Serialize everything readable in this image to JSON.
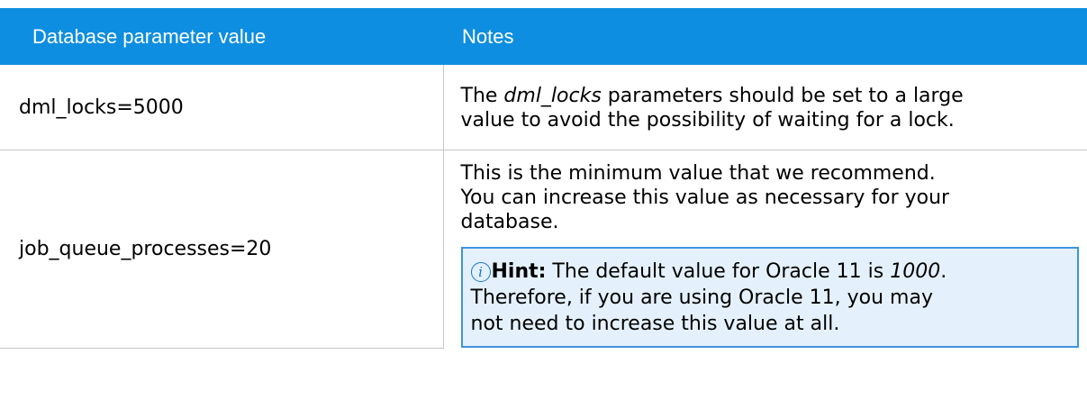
{
  "table": {
    "headers": {
      "parameter": "Database parameter value",
      "notes": "Notes"
    },
    "rows": [
      {
        "parameter": "dml_locks=5000",
        "note": {
          "line1_before": "The ",
          "line1_em": "dml_locks",
          "line1_after": " parameters should be set to a large",
          "line2": "value to avoid the possibility of waiting for a lock."
        }
      },
      {
        "parameter": "job_queue_processes=20",
        "note": {
          "line1": "This is the minimum value that we recommend.",
          "line2": "You can increase this value as necessary for your",
          "line3": "database."
        },
        "hint": {
          "icon": "info-icon",
          "icon_glyph": "i",
          "label": "Hint:",
          "line1_before": " The default value for Oracle 11 is ",
          "line1_em": "1000",
          "line1_after": ".",
          "line2": "Therefore, if you are using Oracle 11, you may",
          "line3": "not need to increase this value at all."
        }
      }
    ]
  },
  "colors": {
    "header_background": "#0e8ee0",
    "header_text": "#ffffff",
    "hint_background": "#e4f1fc",
    "hint_border": "#3d94e0",
    "row_divider": "#c6c6c6"
  }
}
